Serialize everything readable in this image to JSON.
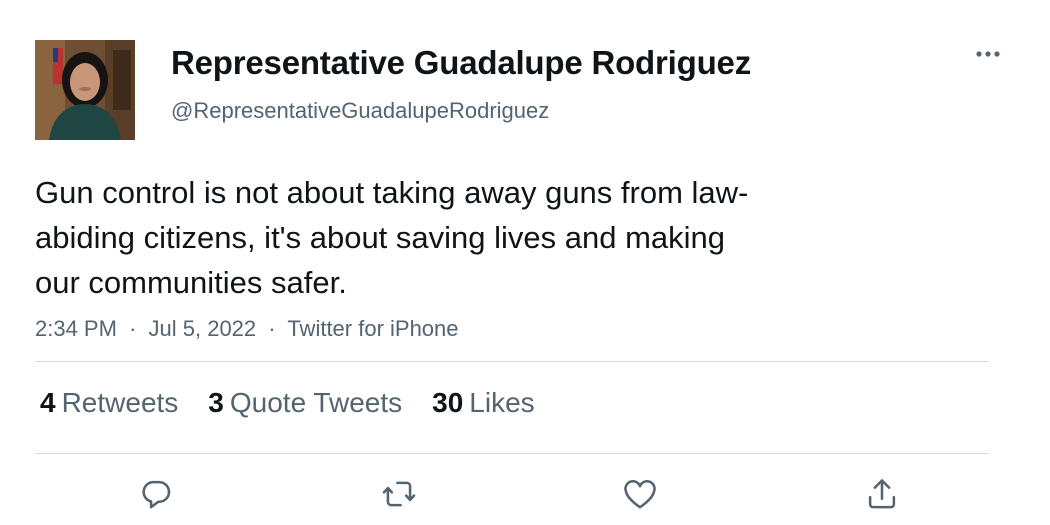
{
  "user": {
    "display_name": "Representative Guadalupe Rodriguez",
    "handle": "@RepresentativeGuadalupeRodriguez"
  },
  "tweet": {
    "text_lines": [
      "Gun control is not about taking away guns from law-",
      "abiding citizens, it's about saving lives and making",
      "our communities safer."
    ],
    "time": "2:34 PM",
    "date": "Jul 5, 2022",
    "source": "Twitter for iPhone",
    "separator": "·"
  },
  "stats": {
    "retweets_count": "4",
    "retweets_label": "Retweets",
    "quotes_count": "3",
    "quotes_label": "Quote Tweets",
    "likes_count": "30",
    "likes_label": "Likes"
  },
  "icons": {
    "more": "more-horizontal-icon",
    "reply": "reply-icon",
    "retweet": "retweet-icon",
    "like": "heart-icon",
    "share": "share-icon"
  },
  "colors": {
    "text": "#0f1419",
    "secondary": "#536471",
    "divider": "#cfd9de"
  }
}
